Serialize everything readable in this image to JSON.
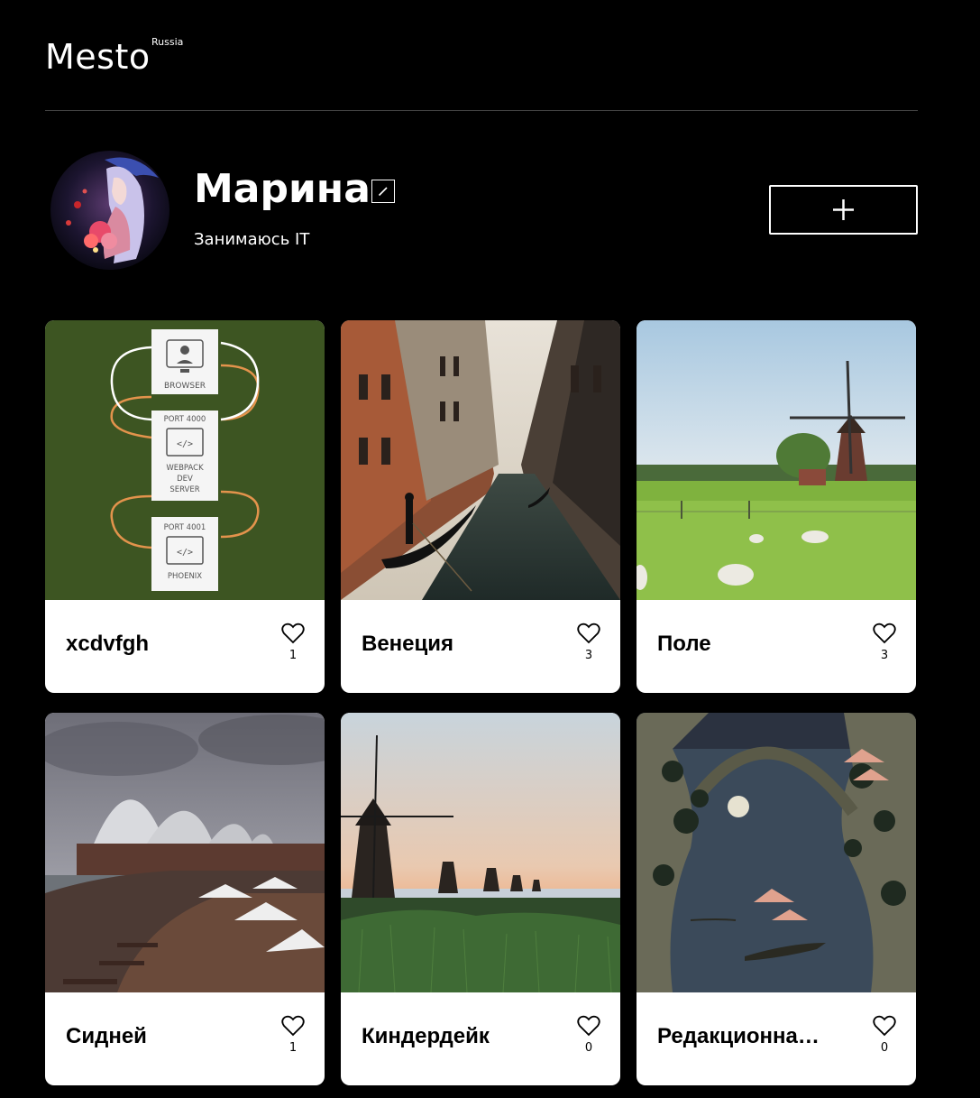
{
  "header": {
    "logo": "Mesto",
    "logo_sup": "Russia"
  },
  "profile": {
    "name": "Марина",
    "about": "Занимаюсь IT",
    "edit_icon": "pencil-icon",
    "add_icon": "plus-icon"
  },
  "cards": [
    {
      "title": "xcdvfgh",
      "likes": "1",
      "image": "dev-server-diagram"
    },
    {
      "title": "Венеция",
      "likes": "3",
      "image": "venice-canal"
    },
    {
      "title": "Поле",
      "likes": "3",
      "image": "windmill-field"
    },
    {
      "title": "Сидней",
      "likes": "1",
      "image": "sydney-opera"
    },
    {
      "title": "Киндердейк",
      "likes": "0",
      "image": "kinderdijk-windmills"
    },
    {
      "title": "Редакционна…",
      "likes": "0",
      "image": "japanese-bridge-print"
    }
  ],
  "diagram_labels": {
    "browser": "BROWSER",
    "port1": "PORT 4000",
    "webpack1": "WEBPACK",
    "webpack2": "DEV",
    "webpack3": "SERVER",
    "port2": "PORT 4001",
    "phoenix": "PHOENIX"
  },
  "colors": {
    "background": "#000000",
    "card": "#ffffff",
    "text_dark": "#000000",
    "diagram_bg": "#3d5522",
    "diagram_arrow": "#e3934c"
  }
}
